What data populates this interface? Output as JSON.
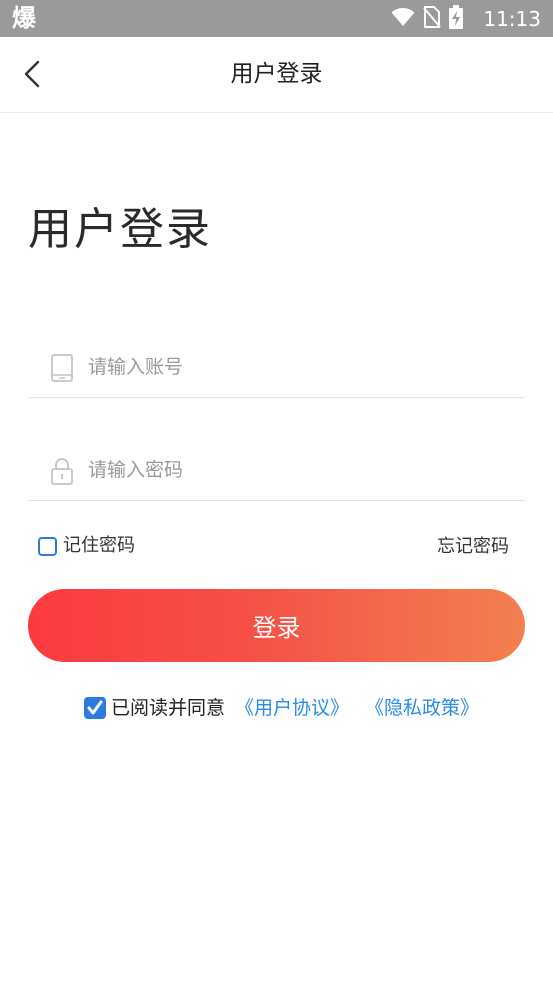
{
  "status_bar": {
    "app_glyph": "爆",
    "time": "11:13",
    "icons": [
      "wifi-icon",
      "no-sim-icon",
      "battery-charging-icon"
    ]
  },
  "nav": {
    "back_icon": "chevron-left-icon",
    "title": "用户登录"
  },
  "heading": "用户登录",
  "account_field": {
    "icon": "phone-icon",
    "placeholder": "请输入账号",
    "value": ""
  },
  "password_field": {
    "icon": "lock-icon",
    "placeholder": "请输入密码",
    "value": ""
  },
  "remember": {
    "label": "记住密码",
    "checked": false
  },
  "forgot_label": "忘记密码",
  "login_button": "登录",
  "agreement": {
    "checked": true,
    "text": "已阅读并同意",
    "user_agreement": "《用户协议》",
    "privacy_policy": "《隐私政策》"
  },
  "colors": {
    "accent_blue": "#2b7be0",
    "link_blue": "#2b8be3",
    "button_gradient_start": "#fb3a3f",
    "button_gradient_end": "#f2804f",
    "status_bar": "#9a9a9a"
  }
}
